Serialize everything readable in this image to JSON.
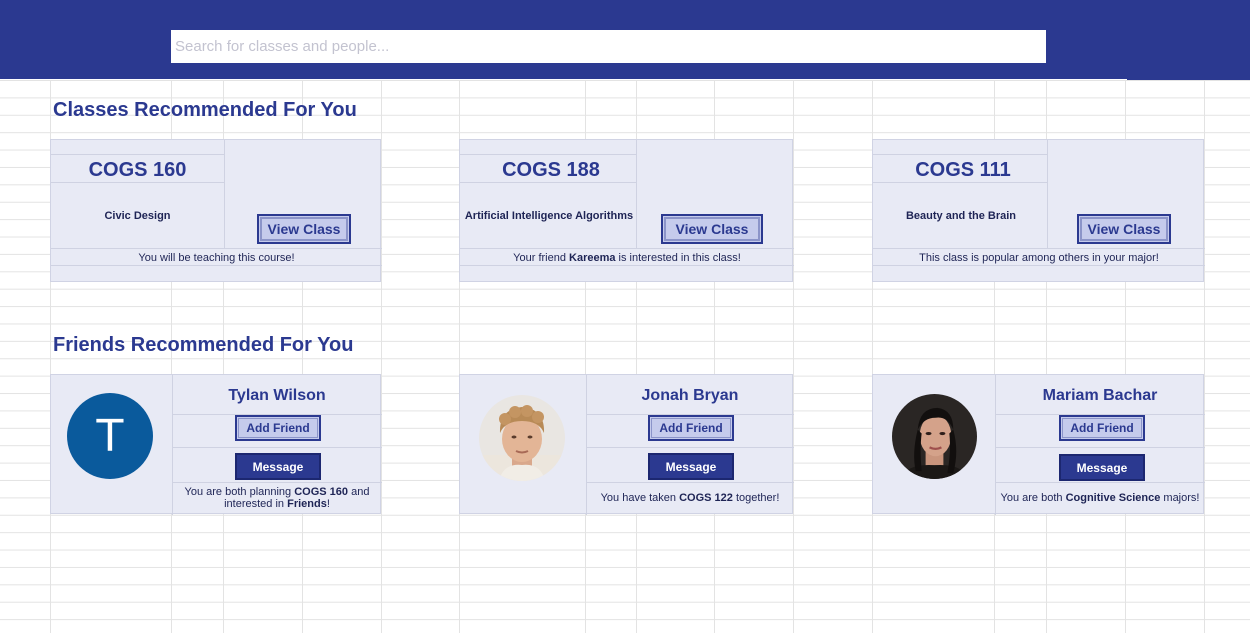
{
  "search": {
    "placeholder": "Search for classes and people..."
  },
  "sections": {
    "classes_title": "Classes Recommended For You",
    "friends_title": "Friends Recommended For You"
  },
  "classes": [
    {
      "code": "COGS 160",
      "name": "Civic Design",
      "button": "View Class",
      "note_pre": "You will be teaching this course!",
      "note_bold": "",
      "note_post": ""
    },
    {
      "code": "COGS 188",
      "name": "Artificial Intelligence Algorithms",
      "button": "View Class",
      "note_pre": "Your friend ",
      "note_bold": "Kareema",
      "note_post": " is interested in this class!"
    },
    {
      "code": "COGS 111",
      "name": "Beauty and the Brain",
      "button": "View Class",
      "note_pre": "This class is popular among others in your major!",
      "note_bold": "",
      "note_post": ""
    }
  ],
  "friends": [
    {
      "name": "Tylan Wilson",
      "avatar_letter": "T",
      "add_label": "Add Friend",
      "message_label": "Message",
      "note_line1_pre": "You are both planning ",
      "note_line1_bold": "COGS 160",
      "note_line1_post": " and",
      "note_line2_pre": "interested in ",
      "note_line2_bold": "Friends",
      "note_line2_post": "!"
    },
    {
      "name": "Jonah Bryan",
      "avatar_letter": "",
      "add_label": "Add Friend",
      "message_label": "Message",
      "note_line1_pre": "You have taken ",
      "note_line1_bold": "COGS 122",
      "note_line1_post": " together!",
      "note_line2_pre": "",
      "note_line2_bold": "",
      "note_line2_post": ""
    },
    {
      "name": "Mariam Bachar",
      "avatar_letter": "",
      "add_label": "Add Friend",
      "message_label": "Message",
      "note_line1_pre": "You are both ",
      "note_line1_bold": "Cognitive Science",
      "note_line1_post": " majors!",
      "note_line2_pre": "",
      "note_line2_bold": "",
      "note_line2_post": ""
    }
  ],
  "colors": {
    "brand": "#2b3990",
    "card_bg": "#e8eaf5",
    "button_light": "#c5cbec",
    "avatar_blue": "#0a5a9c"
  }
}
